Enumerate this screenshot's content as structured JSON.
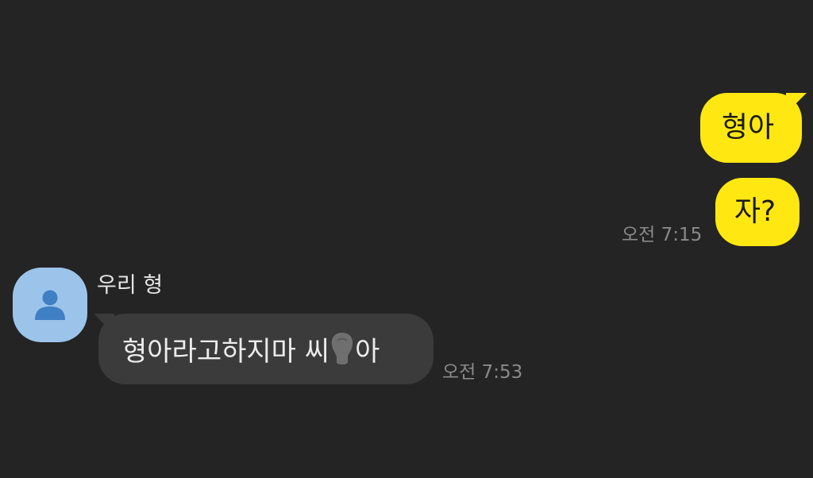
{
  "chat": {
    "outgoing": [
      {
        "text": "형아"
      },
      {
        "text": "자?"
      }
    ],
    "outgoing_timestamp": "오전 7:15",
    "incoming": {
      "sender_name": "우리 형",
      "text_before": "형아라고하지마 씨",
      "text_after": "아",
      "timestamp": "오전 7:53"
    },
    "avatar_icon": "person-icon"
  },
  "colors": {
    "background": "#242424",
    "outgoing_bubble": "#FFE812",
    "incoming_bubble": "#3b3b3b",
    "avatar": "#9cc4ea",
    "timestamp": "#8a8a8a"
  }
}
